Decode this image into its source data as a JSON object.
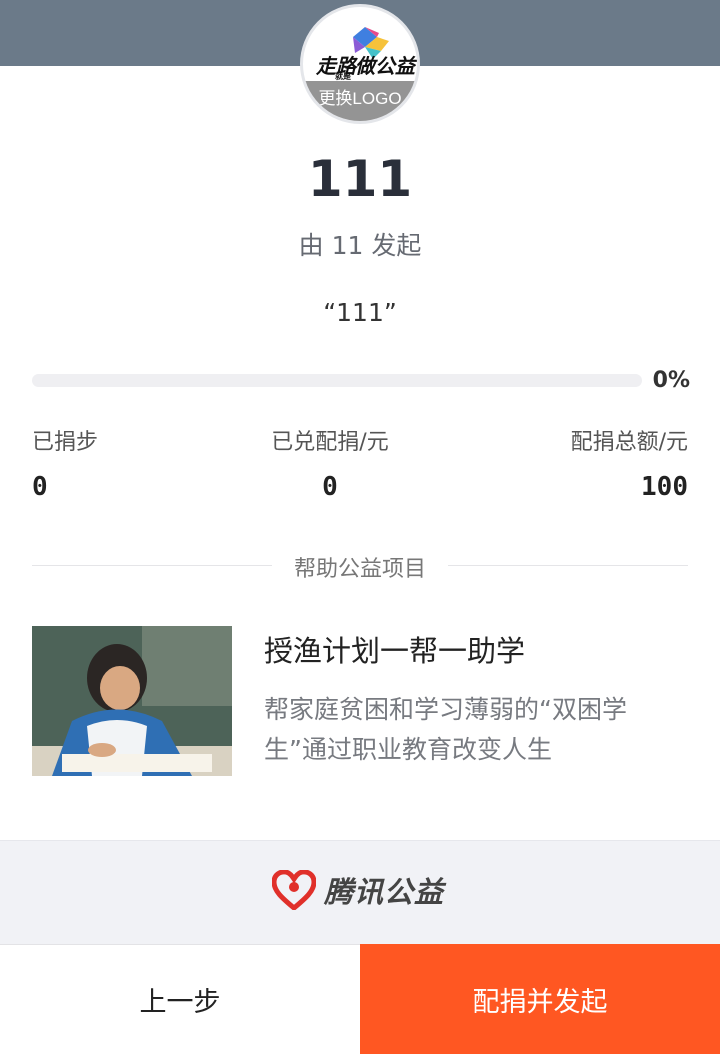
{
  "header": {
    "logo_art_text": "走路就是做公益",
    "logo_change_label": "更换LOGO"
  },
  "event": {
    "title": "111",
    "initiator": "由 11 发起",
    "slogan": "“111”"
  },
  "progress": {
    "fraction": 0,
    "percent_label": "0%"
  },
  "stats": [
    {
      "label": "已捐步",
      "value": "0"
    },
    {
      "label": "已兑配捐/元",
      "value": "0"
    },
    {
      "label": "配捐总额/元",
      "value": "100"
    }
  ],
  "section": {
    "divider_label": "帮助公益项目"
  },
  "project": {
    "title": "授渔计划一帮一助学",
    "description": "帮家庭贫困和学习薄弱的“双困学生”通过职业教育改变人生"
  },
  "footer": {
    "brand_name": "腾讯公益"
  },
  "actions": {
    "prev_label": "上一步",
    "submit_label": "配捐并发起"
  },
  "colors": {
    "accent": "#ff5722",
    "header_band": "#6b7a89"
  },
  "icons": {
    "brand_logo": "tencent-charity-heart-icon"
  }
}
